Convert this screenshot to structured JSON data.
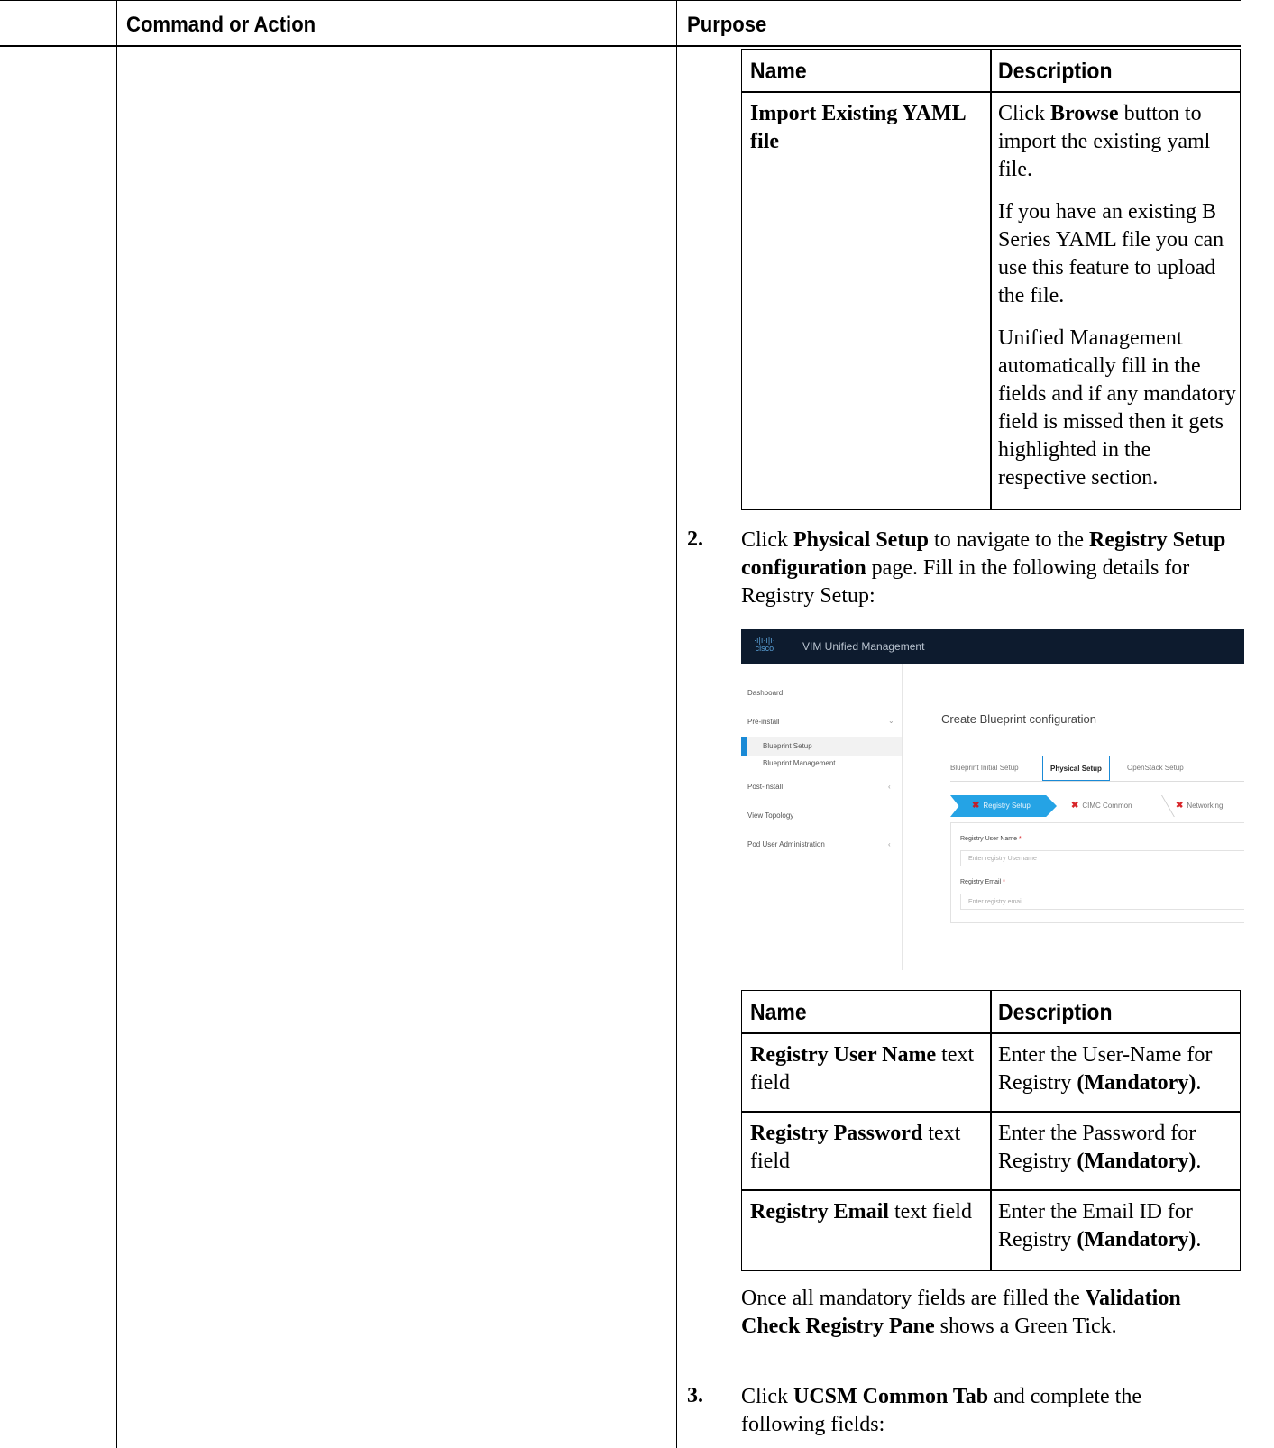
{
  "header": {
    "command_col": "Command or Action",
    "purpose_col": "Purpose"
  },
  "table1": {
    "col_name": "Name",
    "col_desc": "Description",
    "row": {
      "name_bold": "Import Existing YAML file",
      "p1_pre": "Click ",
      "p1_bold": "Browse",
      "p1_post": " button to import the existing yaml file.",
      "p2": "If you have an existing B Series YAML file you can use this feature to upload the file.",
      "p3": "Unified Management automatically fill in the fields and if any mandatory field is missed then it gets highlighted in the respective section."
    }
  },
  "step2": {
    "number": "2.",
    "pre": "Click ",
    "b1": "Physical Setup",
    "mid": " to navigate to the ",
    "b2": "Registry Setup configuration",
    "post": " page. Fill in the following details for Registry Setup:"
  },
  "screenshot": {
    "app_title": "VIM Unified Management",
    "logo_text": "cisco",
    "nav": {
      "dashboard": "Dashboard",
      "pre_install": "Pre-install",
      "blueprint_setup": "Blueprint Setup",
      "blueprint_mgmt": "Blueprint Management",
      "post_install": "Post-install",
      "view_topology": "View Topology",
      "pod_user_admin": "Pod User Administration"
    },
    "page_title": "Create Blueprint configuration",
    "tabs": [
      "Blueprint Initial Setup",
      "Physical Setup",
      "OpenStack Setup"
    ],
    "steps": [
      "Registry Setup",
      "CIMC Common",
      "Networking"
    ],
    "fields": {
      "user_label": "Registry User Name",
      "user_placeholder": "Enter registry Username",
      "email_label": "Registry Email",
      "email_placeholder": "Enter registry email",
      "required_mark": "*"
    }
  },
  "table2": {
    "col_name": "Name",
    "col_desc": "Description",
    "rows": [
      {
        "name_bold": "Registry User Name",
        "name_rest": " text field",
        "desc_pre": "Enter the User-Name for Registry ",
        "desc_bold": "(Mandatory)",
        "desc_post": "."
      },
      {
        "name_bold": "Registry Password",
        "name_rest": " text field",
        "desc_pre": "Enter the Password for Registry ",
        "desc_bold": "(Mandatory)",
        "desc_post": "."
      },
      {
        "name_bold": "Registry Email",
        "name_rest": " text field",
        "desc_pre": "Enter the Email ID for Registry ",
        "desc_bold": "(Mandatory)",
        "desc_post": "."
      }
    ]
  },
  "note": {
    "pre": "Once all mandatory fields are filled the ",
    "bold": "Validation Check Registry Pane",
    "post": " shows a Green Tick."
  },
  "step3": {
    "number": "3.",
    "pre": "Click ",
    "bold": "UCSM Common Tab",
    "post": " and complete the following fields:"
  }
}
